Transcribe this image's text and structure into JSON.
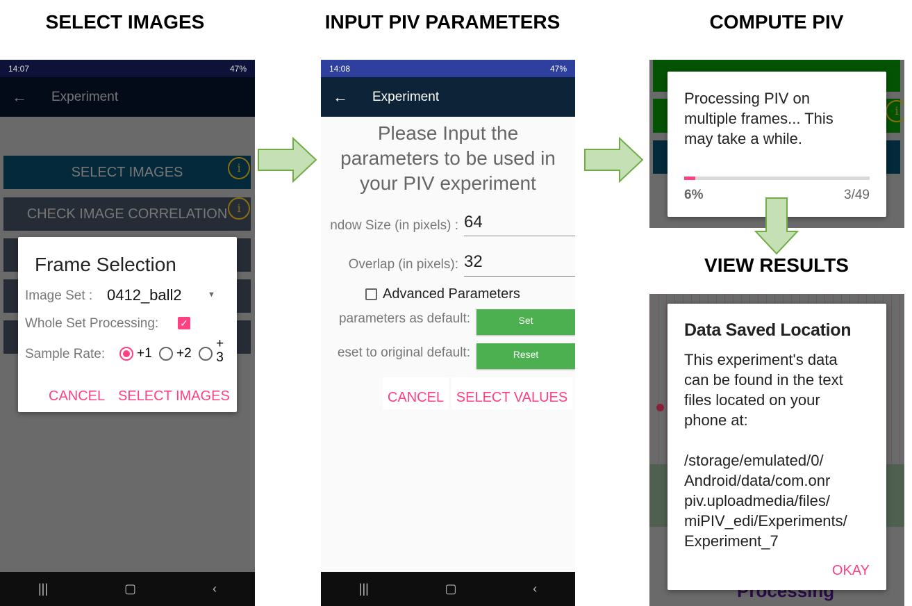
{
  "headings": {
    "select": "SELECT IMAGES",
    "input": "INPUT PIV PARAMETERS",
    "compute": "COMPUTE PIV",
    "view": "VIEW RESULTS"
  },
  "colors": {
    "accent": "#ff4081",
    "green_button": "#4caf50",
    "arrow_fill": "#c5e0b4",
    "arrow_stroke": "#70ad47"
  },
  "phone1": {
    "status": {
      "time": "14:07",
      "battery": "47%"
    },
    "appbar_title": "Experiment",
    "buttons": [
      "SELECT IMAGES",
      "CHECK IMAGE CORRELATION"
    ],
    "dialog": {
      "title": "Frame Selection",
      "image_set_label": "Image Set :",
      "image_set_value": "0412_ball2",
      "whole_set_label": "Whole Set Processing:",
      "whole_set_checked": true,
      "sample_rate_label": "Sample Rate:",
      "sample_rate_options": [
        "+1",
        "+2",
        "+",
        "3"
      ],
      "sample_rate_selected": "+1",
      "cancel": "CANCEL",
      "confirm": "SELECT IMAGES"
    }
  },
  "phone2": {
    "status": {
      "time": "14:08",
      "battery": "47%"
    },
    "appbar_title": "Experiment",
    "intro": [
      "Please Input the",
      "parameters to be used in",
      "your PIV experiment"
    ],
    "window_label": "ndow Size (in pixels) :",
    "window_value": "64",
    "overlap_label": "Overlap (in pixels):",
    "overlap_value": "32",
    "advanced_label": "Advanced Parameters",
    "advanced_checked": false,
    "set_label": "parameters as default:",
    "set_button": "Set",
    "reset_label": "eset to original default:",
    "reset_button": "Reset",
    "cancel": "CANCEL",
    "confirm": "SELECT VALUES"
  },
  "phone3": {
    "dialog_text": [
      "Processing PIV on",
      "multiple frames... This",
      "may take a while."
    ],
    "progress_percent": 6,
    "progress_label": "6%",
    "progress_count": "3/49"
  },
  "phone4": {
    "title": "Data Saved Location",
    "body": [
      "This experiment's data",
      "can be found in the text",
      "files located on your",
      "phone at:"
    ],
    "path": [
      "/storage/emulated/0/",
      "Android/data/com.onr",
      "piv.uploadmedia/files/",
      "miPIV_edi/Experiments/",
      "Experiment_7"
    ],
    "ok": "OKAY",
    "background_text": "Processing"
  }
}
